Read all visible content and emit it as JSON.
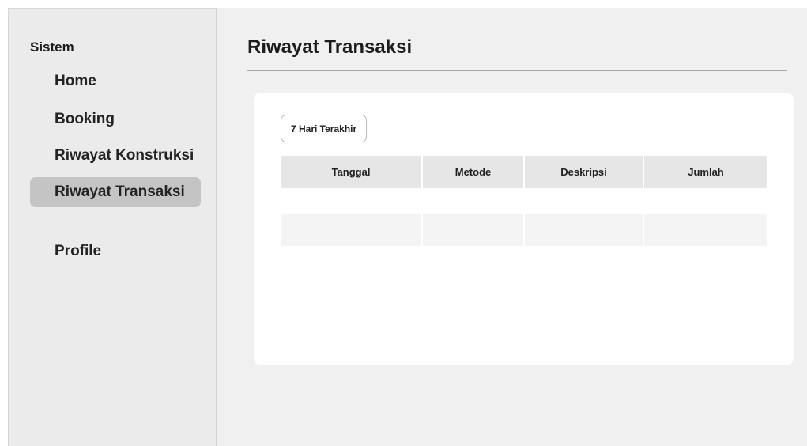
{
  "sidebar": {
    "heading": "Sistem",
    "items": [
      {
        "label": "Home",
        "active": false
      },
      {
        "label": "Booking",
        "active": false
      },
      {
        "label": "Riwayat Konstruksi",
        "active": false
      },
      {
        "label": "Riwayat Transaksi",
        "active": true
      },
      {
        "label": "Profile",
        "active": false
      }
    ]
  },
  "main": {
    "title": "Riwayat Transaksi",
    "filter_label": "7 Hari Terakhir",
    "table": {
      "columns": [
        "Tanggal",
        "Metode",
        "Deskripsi",
        "Jumlah"
      ],
      "rows": [
        [
          "",
          "",
          "",
          ""
        ]
      ]
    }
  },
  "colors": {
    "sidebar_bg": "#ebebeb",
    "active_item_bg": "#c4c4c4",
    "main_bg": "#f0f0f0",
    "card_bg": "#ffffff",
    "table_header_bg": "#e6e6e6"
  }
}
